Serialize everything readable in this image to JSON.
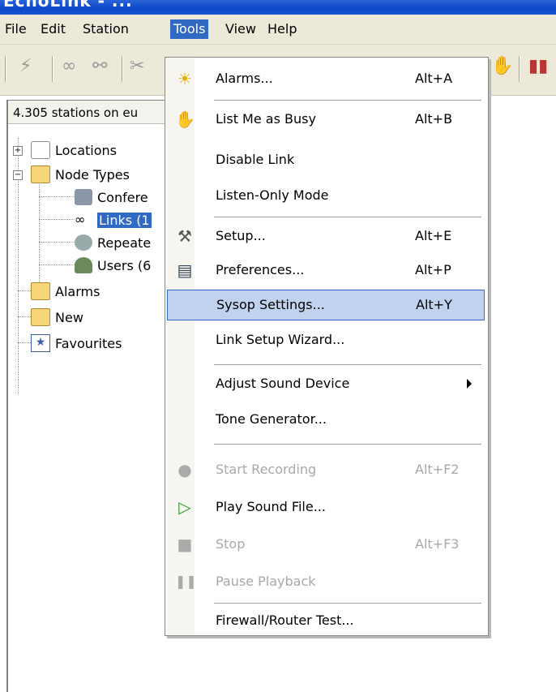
{
  "window": {
    "title": "EchoLink - ..."
  },
  "menubar": {
    "items": [
      {
        "label": "File"
      },
      {
        "label": "Edit"
      },
      {
        "label": "Station"
      },
      {
        "label": "Tools"
      },
      {
        "label": "View"
      },
      {
        "label": "Help"
      }
    ]
  },
  "panel": {
    "header": "4.305 stations on eu"
  },
  "tree": {
    "locations": "Locations",
    "node_types": "Node Types",
    "conference": "Confere",
    "links": "Links (1",
    "repeaters": "Repeate",
    "users": "Users (6",
    "alarms": "Alarms",
    "new": "New",
    "favourites": "Favourites"
  },
  "tools_menu": {
    "alarms": {
      "label": "Alarms...",
      "shortcut": "Alt+A"
    },
    "busy": {
      "label": "List Me as Busy",
      "shortcut": "Alt+B"
    },
    "disable_link": {
      "label": "Disable Link"
    },
    "listen_only": {
      "label": "Listen-Only Mode"
    },
    "setup": {
      "label": "Setup...",
      "shortcut": "Alt+E"
    },
    "preferences": {
      "label": "Preferences...",
      "shortcut": "Alt+P"
    },
    "sysop": {
      "label": "Sysop Settings...",
      "shortcut": "Alt+Y"
    },
    "wizard": {
      "label": "Link Setup Wizard..."
    },
    "sound_device": {
      "label": "Adjust Sound Device"
    },
    "tone": {
      "label": "Tone Generator..."
    },
    "start_rec": {
      "label": "Start Recording",
      "shortcut": "Alt+F2"
    },
    "play_sound": {
      "label": "Play Sound File..."
    },
    "stop": {
      "label": "Stop",
      "shortcut": "Alt+F3"
    },
    "pause": {
      "label": "Pause Playback"
    },
    "firewall": {
      "label": "Firewall/Router Test..."
    }
  },
  "colors": {
    "highlight": "#c1d2ee",
    "menu_active": "#316ac5",
    "titlebar": "#0a46c8"
  }
}
